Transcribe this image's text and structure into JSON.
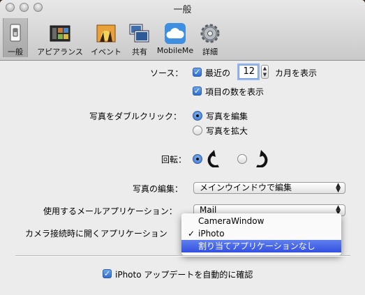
{
  "window": {
    "title": "一般"
  },
  "toolbar": {
    "items": [
      {
        "label": "一般",
        "icon": "light-switch-icon",
        "selected": true
      },
      {
        "label": "アピアランス",
        "icon": "appearance-icon"
      },
      {
        "label": "イベント",
        "icon": "events-icon"
      },
      {
        "label": "共有",
        "icon": "sharing-icon"
      },
      {
        "label": "MobileMe",
        "icon": "cloud-icon"
      },
      {
        "label": "詳細",
        "icon": "gear-icon"
      }
    ]
  },
  "source": {
    "label": "ソース：",
    "recent_prefix": "最近の",
    "months_value": "12",
    "months_suffix": "カ月を表示",
    "show_count_label": "項目の数を表示"
  },
  "double_click": {
    "label": "写真をダブルクリック：",
    "options": [
      "写真を編集",
      "写真を拡大"
    ]
  },
  "rotate": {
    "label": "回転："
  },
  "edit_photo": {
    "label": "写真の編集：",
    "value": "メインウインドウで編集"
  },
  "email_app": {
    "label": "使用するメールアプリケーション：",
    "value": "Mail"
  },
  "camera_app": {
    "label": "カメラ接続時に開くアプリケーション",
    "menu_items": [
      "CameraWindow",
      "iPhoto",
      "割り当てアプリケーションなし"
    ],
    "checked_item": "✓"
  },
  "updates": {
    "label": "iPhoto アップデートを自動的に確認"
  },
  "colors": {
    "accent": "#3451e0",
    "toolbar_bg": "#d4d4d4",
    "window_bg": "#ececec"
  }
}
